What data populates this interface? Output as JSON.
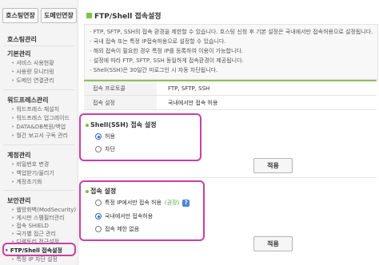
{
  "top_buttons": [
    "호스팅연장",
    "도메인연장"
  ],
  "sidebar": {
    "hosting_title": "호스팅관리",
    "basic_title": "기본관리",
    "basic_items": [
      "서비스 사용현황",
      "사용량 모니터링",
      "도메인 연결관리"
    ],
    "wp_title": "워드프레스관리",
    "wp_items": [
      "워드프레스 재설치",
      "워드프레스 업그레이드",
      "DATA&DB복원/백업",
      "월간 보고서 구독 관리"
    ],
    "account_title": "계정관리",
    "account_items": [
      "비밀번호 변경",
      "백업받기/올리기",
      "계정초기화"
    ],
    "security_title": "보안관리",
    "security_items": [
      "웹방화벽(ModSecurity)",
      "게시판 스팸필터관리",
      "접속 SHIELD",
      "국가별 접근 관리",
      "디렉토리 접근설정"
    ],
    "active_item": "FTP/Shell 접속설정",
    "last_item": "특정 IP 차단 설정"
  },
  "main": {
    "title": "FTP/Shell 접속설정",
    "desc": [
      "FTP, SFTP, SSH의 접속 환경을 제한할 수 있습니다. 호스팅 신청 후 기본 설정은 국내에서만 접속허용으로 설정됩니다.",
      "국내 접속 또는 특정 IP접속허용으로 설정할 수 있습니다.",
      "해외 접속이 필요한 경우 특정 IP를 등록하여 이용이 가능합니다.",
      "설정에 따라 FTP, SFTP, SSH 동일하게 접속환경이 제공됩니다.",
      "Shell(SSH)은 30일간 미로그인 시 자동 차단됩니다."
    ],
    "table": [
      {
        "label": "접속 프로토콜",
        "value": "FTP, SFTP, SSH"
      },
      {
        "label": "접속 설정",
        "value": "국내에서만 접속 허용"
      }
    ],
    "shell_panel": {
      "title": "Shell(SSH) 접속 설정",
      "options": [
        "허용",
        "차단"
      ],
      "selected": 0
    },
    "apply_label": "적용",
    "access_panel": {
      "title": "접속 설정",
      "option1": "특정 IP에서만 접속 허용",
      "option1_tag": "(권장)",
      "option2": "국내에서만 접속허용",
      "option3": "접속 제한 없음",
      "selected": 1,
      "help": "?"
    },
    "apply_label2": "적용"
  },
  "colors": {
    "accent": "#7cc244",
    "highlight": "#c93fa3",
    "radio_on": "#2a66c8"
  }
}
